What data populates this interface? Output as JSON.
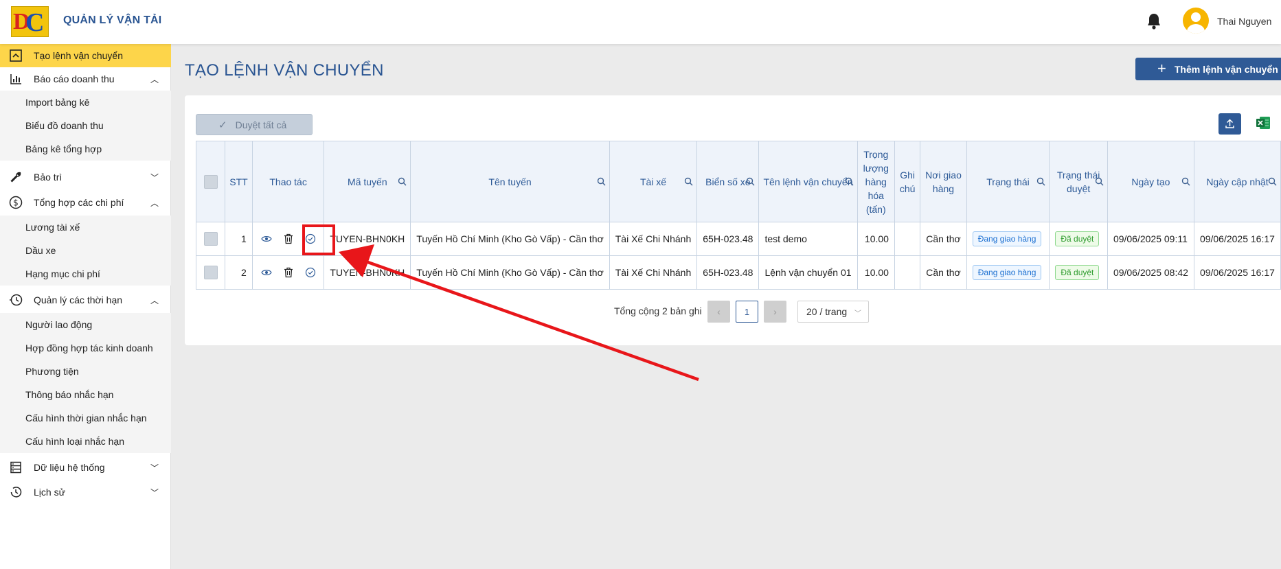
{
  "header": {
    "app_title": "QUẢN LÝ VẬN TẢI",
    "user_name": "Thai Nguyen"
  },
  "sidebar": {
    "items": [
      {
        "label": "Tạo lệnh vận chuyển",
        "icon": "chevron-up-square-icon",
        "active": true
      },
      {
        "label": "Báo cáo doanh thu",
        "icon": "bar-chart-icon",
        "expanded": true
      },
      {
        "label": "Import bảng kê",
        "sub": true
      },
      {
        "label": "Biểu đồ doanh thu",
        "sub": true
      },
      {
        "label": "Bảng kê tổng hợp",
        "sub": true
      },
      {
        "label": "Bảo trì",
        "icon": "wrench-icon",
        "expanded": false
      },
      {
        "label": "Tổng hợp các chi phí",
        "icon": "dollar-circle-icon",
        "expanded": true
      },
      {
        "label": "Lương tài xế",
        "sub": true
      },
      {
        "label": "Dầu xe",
        "sub": true
      },
      {
        "label": "Hạng mục chi phí",
        "sub": true
      },
      {
        "label": "Quản lý các thời hạn",
        "icon": "clock-history-icon",
        "expanded": true
      },
      {
        "label": "Người lao động",
        "sub": true
      },
      {
        "label": "Hợp đồng hợp tác kinh doanh",
        "sub": true
      },
      {
        "label": "Phương tiện",
        "sub": true
      },
      {
        "label": "Thông báo nhắc hạn",
        "sub": true
      },
      {
        "label": "Cấu hình thời gian nhắc hạn",
        "sub": true
      },
      {
        "label": "Cấu hình loại nhắc hạn",
        "sub": true
      },
      {
        "label": "Dữ liệu hệ thống",
        "icon": "database-icon",
        "expanded": false
      },
      {
        "label": "Lịch sử",
        "icon": "history-icon",
        "expanded": false
      }
    ]
  },
  "main": {
    "page_title": "TẠO LỆNH VẬN CHUYỂN",
    "add_button": "Thêm lệnh vận chuyển",
    "approve_all": "Duyệt tất cả",
    "columns": [
      "STT",
      "Thao tác",
      "Mã tuyến",
      "Tên tuyến",
      "Tài xế",
      "Biển số xe",
      "Tên lệnh vận chuyển",
      "Trọng lượng hàng hóa (tấn)",
      "Ghi chú",
      "Nơi giao hàng",
      "Trạng thái",
      "Trạng thái duyệt",
      "Ngày tạo",
      "Ngày cập nhật"
    ],
    "rows": [
      {
        "stt": "1",
        "ma_tuyen": "TUYEN-BHN0KH",
        "ten_tuyen": "Tuyến Hồ Chí Minh (Kho Gò Vấp) - Cần thơ",
        "tai_xe": "Tài Xế Chi Nhánh",
        "bien_so": "65H-023.48",
        "ten_lenh": "test demo",
        "trong_luong": "10.00",
        "ghi_chu": "",
        "noi_giao": "Cần thơ",
        "trang_thai": "Đang giao hàng",
        "trang_thai_duyet": "Đã duyệt",
        "ngay_tao": "09/06/2025 09:11",
        "ngay_cap_nhat": "09/06/2025 16:17"
      },
      {
        "stt": "2",
        "ma_tuyen": "TUYEN-BHN0KH",
        "ten_tuyen": "Tuyến Hồ Chí Minh (Kho Gò Vấp) - Cần thơ",
        "tai_xe": "Tài Xế Chi Nhánh",
        "bien_so": "65H-023.48",
        "ten_lenh": "Lệnh vận chuyển 01",
        "trong_luong": "10.00",
        "ghi_chu": "",
        "noi_giao": "Cần thơ",
        "trang_thai": "Đang giao hàng",
        "trang_thai_duyet": "Đã duyệt",
        "ngay_tao": "09/06/2025 08:42",
        "ngay_cap_nhat": "09/06/2025 16:17"
      }
    ],
    "pagination": {
      "total": "Tổng cộng 2 bản ghi",
      "page": "1",
      "page_size": "20 / trang"
    }
  },
  "colors": {
    "primary": "#2f5a96",
    "active_menu": "#fdd54a",
    "annotation": "#e8161a"
  }
}
